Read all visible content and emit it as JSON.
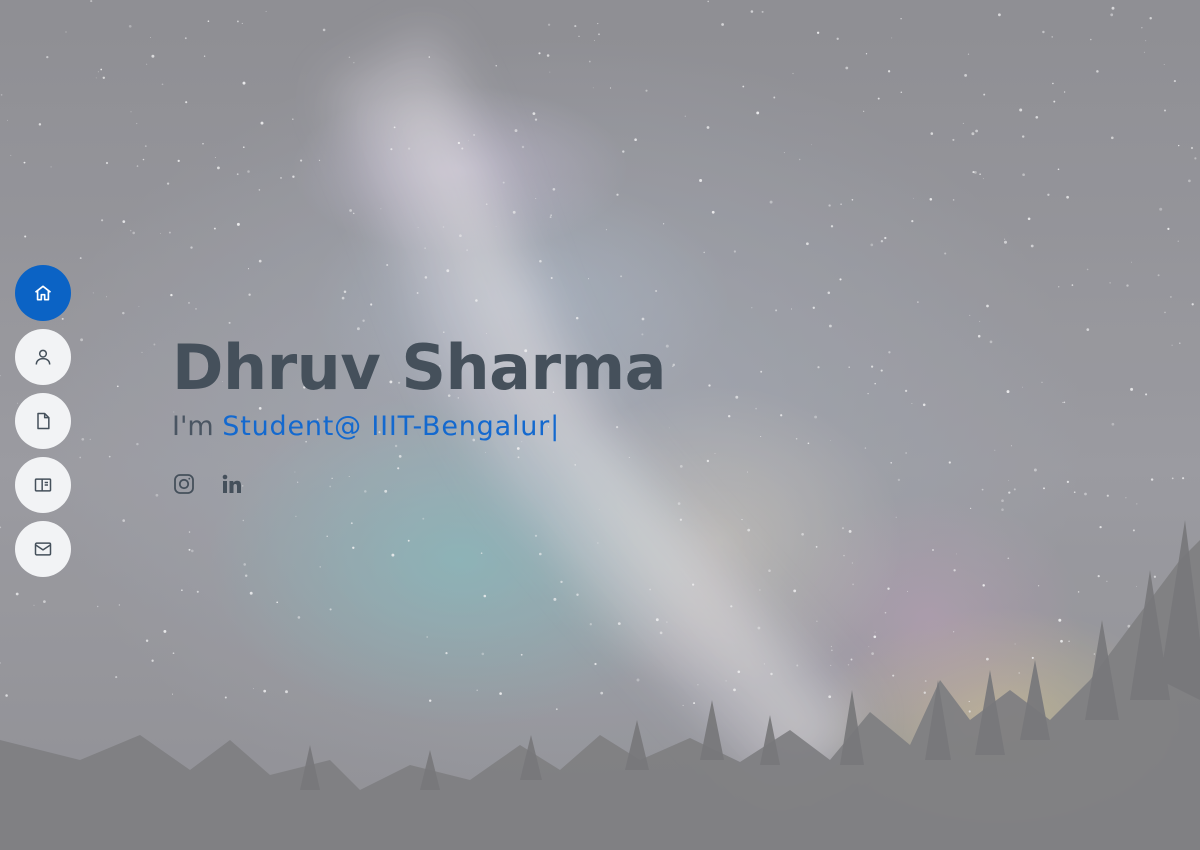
{
  "page": {
    "accent_color": "#0b63c5"
  },
  "nav": {
    "items": [
      {
        "icon": "home-icon",
        "active": true
      },
      {
        "icon": "user-icon",
        "active": false
      },
      {
        "icon": "file-icon",
        "active": false
      },
      {
        "icon": "book-icon",
        "active": false
      },
      {
        "icon": "envelope-icon",
        "active": false
      }
    ]
  },
  "hero": {
    "name": "Dhruv Sharma",
    "prefix": "I'm",
    "typed_text": "Student@ IIIT-Bengalur|",
    "background": "night sky with milky way over pine forest",
    "social": [
      {
        "icon": "instagram-icon"
      },
      {
        "icon": "linkedin-icon"
      }
    ]
  }
}
